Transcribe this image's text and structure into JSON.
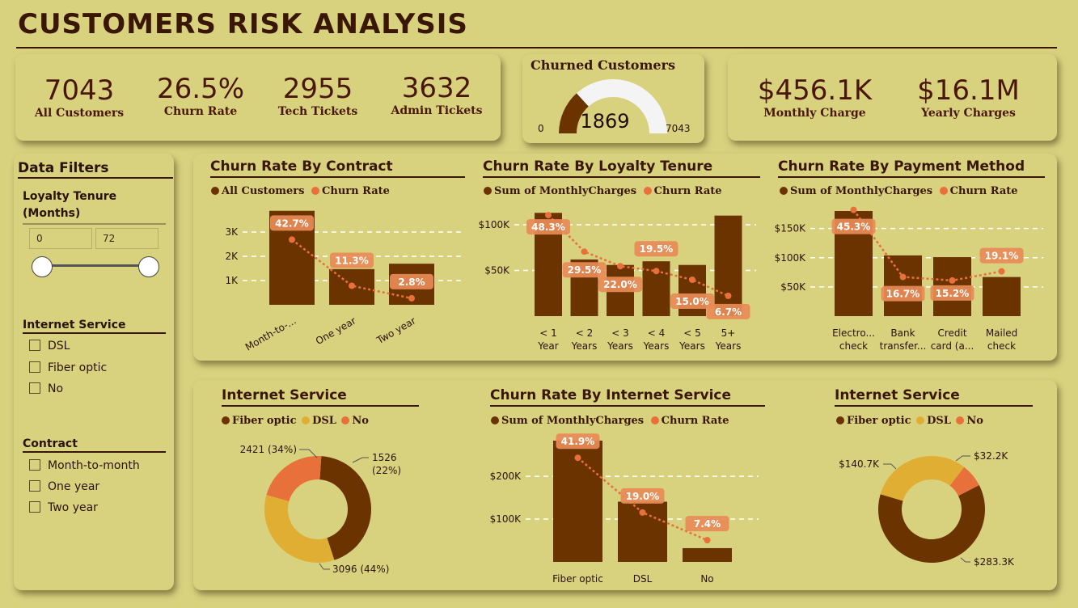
{
  "title": "CUSTOMERS RISK ANALYSIS",
  "kpis": {
    "all_customers": {
      "value": "7043",
      "label": "All Customers"
    },
    "churn_rate": {
      "value": "26.5%",
      "label": "Churn Rate"
    },
    "tech_tickets": {
      "value": "2955",
      "label": "Tech Tickets"
    },
    "admin_tickets": {
      "value": "3632",
      "label": "Admin Tickets"
    },
    "monthly_charge": {
      "value": "$456.1K",
      "label": "Monthly Charge"
    },
    "yearly_charges": {
      "value": "$16.1M",
      "label": "Yearly Charges"
    }
  },
  "gauge": {
    "title": "Churned Customers",
    "value": "1869",
    "min": "0",
    "max": "7043",
    "fraction": 0.2654
  },
  "filters": {
    "title": "Data Filters",
    "tenure": {
      "label": "Loyalty Tenure (Months)",
      "min": "0",
      "max": "72"
    },
    "internet": {
      "label": "Internet Service",
      "options": [
        "DSL",
        "Fiber optic",
        "No"
      ]
    },
    "contract": {
      "label": "Contract",
      "options": [
        "Month-to-month",
        "One year",
        "Two year"
      ]
    }
  },
  "colors": {
    "dark": "#6b3300",
    "orange": "#e8703a",
    "gold": "#e0ae32",
    "bg": "#d8d27f"
  },
  "chart_data": [
    {
      "type": "bar",
      "title": "Churn Rate By Contract",
      "legend": [
        "All Customers",
        "Churn Rate"
      ],
      "categories": [
        "Month-to-...",
        "One year",
        "Two year"
      ],
      "series": [
        {
          "name": "All Customers",
          "values": [
            3875,
            1473,
            1695
          ]
        },
        {
          "name": "Churn Rate",
          "values": [
            42.7,
            11.3,
            2.8
          ],
          "labels": [
            "42.7%",
            "11.3%",
            "2.8%"
          ]
        }
      ],
      "yticks": [
        "1K",
        "2K",
        "3K"
      ],
      "ylim": [
        0,
        3900
      ]
    },
    {
      "type": "bar",
      "title": "Churn Rate By Loyalty Tenure",
      "legend": [
        "Sum of MonthlyCharges",
        "Churn Rate"
      ],
      "categories": [
        "< 1 Year",
        "< 2 Years",
        "< 3 Years",
        "< 4 Years",
        "< 5 Years",
        "5+ Years"
      ],
      "series": [
        {
          "name": "Sum of MonthlyCharges",
          "values": [
            113000,
            62000,
            56000,
            60000,
            56000,
            110000
          ]
        },
        {
          "name": "Churn Rate",
          "values": [
            48.3,
            29.5,
            22.0,
            19.5,
            15.0,
            6.7
          ],
          "labels": [
            "48.3%",
            "29.5%",
            "22.0%",
            "19.5%",
            "15.0%",
            "6.7%"
          ]
        }
      ],
      "yticks": [
        "$50K",
        "$100K"
      ],
      "ylim": [
        0,
        115000
      ]
    },
    {
      "type": "bar",
      "title": "Churn Rate By Payment Method",
      "legend": [
        "Sum of MonthlyCharges",
        "Churn Rate"
      ],
      "categories": [
        "Electro... check",
        "Bank transfer...",
        "Credit card (a...",
        "Mailed check"
      ],
      "series": [
        {
          "name": "Sum of MonthlyCharges",
          "values": [
            180000,
            104000,
            101000,
            67000
          ]
        },
        {
          "name": "Churn Rate",
          "values": [
            45.3,
            16.7,
            15.2,
            19.1
          ],
          "labels": [
            "45.3%",
            "16.7%",
            "15.2%",
            "19.1%"
          ]
        }
      ],
      "yticks": [
        "$50K",
        "$100K",
        "$150K"
      ],
      "ylim": [
        0,
        180000
      ]
    },
    {
      "type": "pie",
      "title": "Internet Service",
      "legend": [
        "Fiber optic",
        "DSL",
        "No"
      ],
      "values": [
        3096,
        2421,
        1526
      ],
      "labels": [
        "3096 (44%)",
        "2421 (34%)",
        "1526 (22%)"
      ]
    },
    {
      "type": "bar",
      "title": "Churn Rate By Internet Service",
      "legend": [
        "Sum of MonthlyCharges",
        "Churn Rate"
      ],
      "categories": [
        "Fiber optic",
        "DSL",
        "No"
      ],
      "series": [
        {
          "name": "Sum of MonthlyCharges",
          "values": [
            283300,
            140700,
            32200
          ]
        },
        {
          "name": "Churn Rate",
          "values": [
            41.9,
            19.0,
            7.4
          ],
          "labels": [
            "41.9%",
            "19.0%",
            "7.4%"
          ]
        }
      ],
      "yticks": [
        "$100K",
        "$200K"
      ],
      "ylim": [
        0,
        283300
      ]
    },
    {
      "type": "pie",
      "title": "Internet Service",
      "legend": [
        "Fiber optic",
        "DSL",
        "No"
      ],
      "values": [
        283.3,
        140.7,
        32.2
      ],
      "labels": [
        "$283.3K",
        "$140.7K",
        "$32.2K"
      ]
    }
  ]
}
